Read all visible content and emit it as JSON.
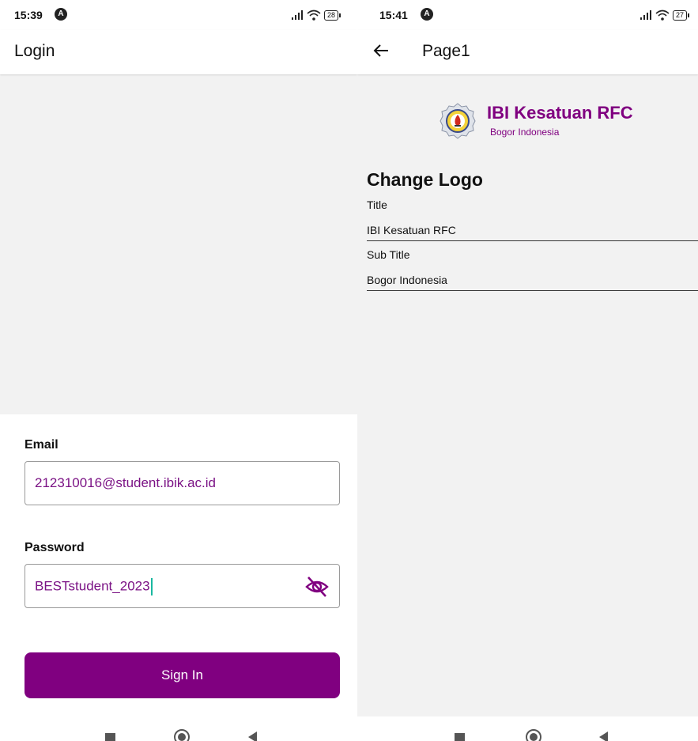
{
  "left": {
    "status": {
      "time": "15:39",
      "notif_glyph": "A",
      "battery": "28"
    },
    "appbar": {
      "title": "Login"
    },
    "email": {
      "label": "Email",
      "value": "212310016@student.ibik.ac.id"
    },
    "password": {
      "label": "Password",
      "value": "BESTstudent_2023"
    },
    "signin_label": "Sign In"
  },
  "right": {
    "status": {
      "time": "15:41",
      "notif_glyph": "A",
      "battery": "27"
    },
    "appbar": {
      "title": "Page1"
    },
    "logo": {
      "title": "IBI Kesatuan RFC",
      "subtitle": "Bogor Indonesia"
    },
    "section_heading": "Change Logo",
    "title_field": {
      "label": "Title",
      "value": "IBI Kesatuan RFC"
    },
    "subtitle_field": {
      "label": "Sub Title",
      "value": "Bogor Indonesia"
    }
  },
  "icons": {
    "signal": "signal-bars-icon",
    "wifi": "wifi-icon",
    "battery": "battery-icon",
    "eye_off": "eye-off-icon",
    "back": "arrow-left-icon",
    "nav_recents": "square-icon",
    "nav_home": "circle-icon",
    "nav_back": "triangle-back-icon"
  },
  "colors": {
    "accent": "#800080",
    "background": "#f2f2f2",
    "surface": "#ffffff",
    "caret": "#1ab8a0"
  }
}
